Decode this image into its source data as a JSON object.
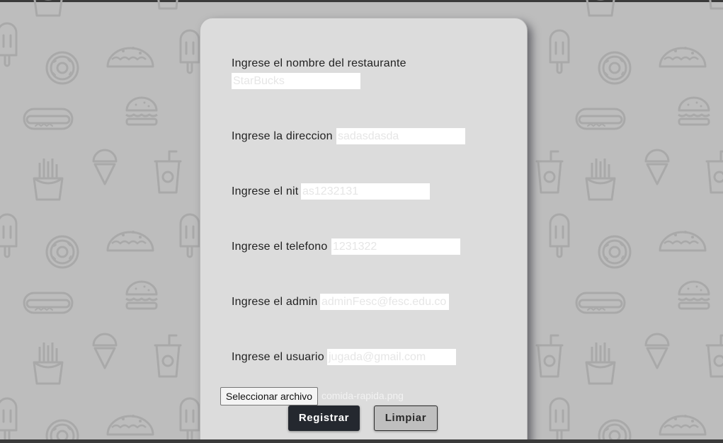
{
  "form": {
    "fields": [
      {
        "label": "Ingrese el nombre del restaurante",
        "value": "StarBucks"
      },
      {
        "label": "Ingrese la direccion",
        "value": "sadasdasda"
      },
      {
        "label": "Ingrese el nit",
        "value": "as1232131"
      },
      {
        "label": "Ingrese el telefono",
        "value": "1231322"
      },
      {
        "label": "Ingrese el admin",
        "value": "adminFesc@fesc.edu.co"
      },
      {
        "label": "Ingrese el usuario",
        "value": "jugada@gmail.com"
      }
    ],
    "file_button_label": "Seleccionar archivo",
    "file_name": "comida-rapida.png",
    "register_label": "Registrar",
    "clear_label": "Limpiar"
  },
  "colors": {
    "background": "#bdbdbd",
    "pattern_stroke": "#a9a9a9",
    "card": "#dcdcdc",
    "primary_button": "#24282f",
    "secondary_button": "#bfbfbf"
  },
  "icons": [
    "popsicle-icon",
    "donut-icon",
    "taco-icon",
    "hotdog-icon",
    "burger-icon",
    "fries-icon",
    "ice-cream-icon",
    "soda-cup-icon"
  ]
}
